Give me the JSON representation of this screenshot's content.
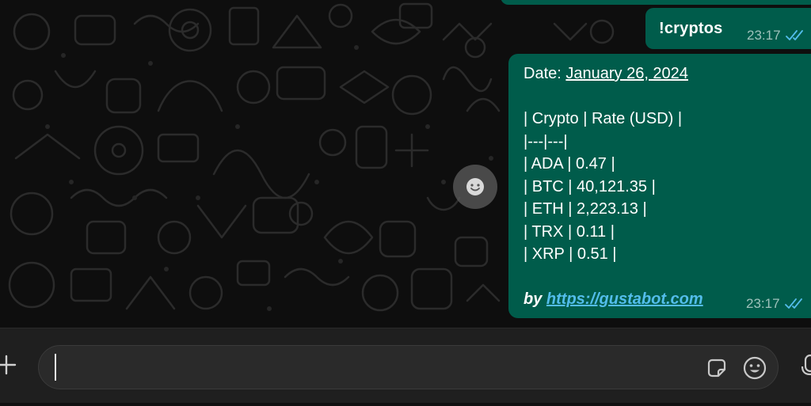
{
  "chat": {
    "messages": [
      {
        "text": "!cryptos",
        "time": "23:17",
        "status_icon": "double-check-read-icon"
      },
      {
        "lines": [
          "",
          "| Crypto | Rate (USD) |",
          "|---|---|",
          "| ADA | 0.47 |",
          "| BTC | 40,121.35 |",
          "| ETH | 2,223.13 |",
          "| TRX | 0.11 |",
          "| XRP | 0.51 |",
          ""
        ],
        "date_label": "Date: ",
        "date_value": "January 26, 2024",
        "signature_prefix": "by ",
        "signature_url": "https://gustabot.com",
        "time": "23:17",
        "status_icon": "double-check-read-icon"
      }
    ],
    "scroll_button_icon": "smiley-icon"
  },
  "composer": {
    "placeholder": "",
    "attach_icon": "plus-icon",
    "sticker_icon": "sticker-icon",
    "emoji_icon": "emoji-icon",
    "mic_icon": "microphone-icon"
  },
  "colors": {
    "outgoing_bubble": "#005c4b",
    "read_ticks": "#53bdeb",
    "background": "#0e0e0e",
    "footer": "#1f1f1f"
  }
}
